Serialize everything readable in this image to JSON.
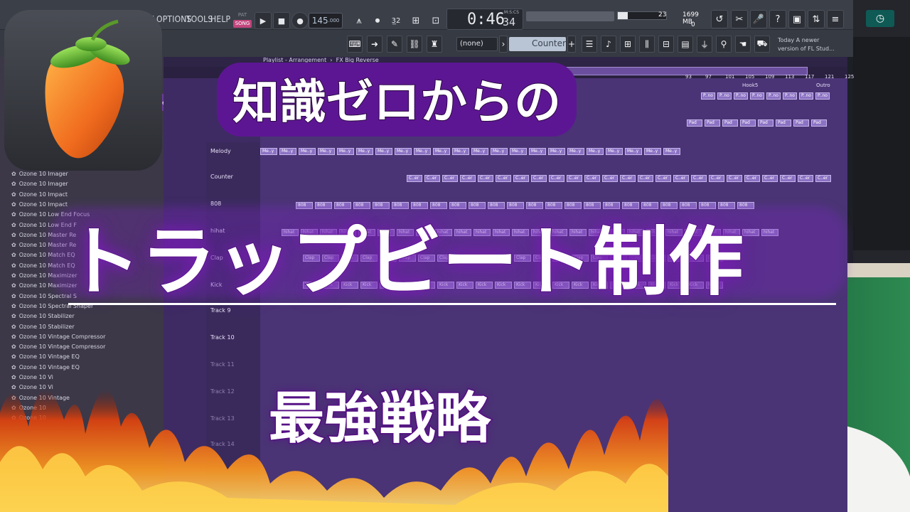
{
  "menu": {
    "items": [
      "W",
      "OPTIONS",
      "TOOLS",
      "HELP"
    ]
  },
  "transport": {
    "pat_label": "PAT",
    "song_label": "SONG",
    "tempo": "145",
    "tempo_fraction": ".000",
    "time_big": "0:46",
    "time_small": "34",
    "time_label": "M:S:CS"
  },
  "cpu": {
    "cpu_count": "23",
    "memory": "1699 MB",
    "voices": "0"
  },
  "toolbar2": {
    "pattern_select": "(none)",
    "counter_label": "Counter",
    "hint_line1": "Today  A newer",
    "hint_line2": "version of FL Stud..."
  },
  "playlist": {
    "title": "Playlist - Arrangement",
    "subtitle": "FX Big Reverse",
    "ruler": [
      "93",
      "97",
      "101",
      "105",
      "109",
      "113",
      "117",
      "121",
      "125"
    ],
    "markers": [
      "Hook5",
      "Outro"
    ],
    "tracks": [
      "Melody",
      "Counter",
      "808",
      "hihat",
      "Clap",
      "Kick",
      "Track 9",
      "Track 10",
      "Track 11",
      "Track 12",
      "Track 13",
      "Track 14"
    ],
    "reverse_label": "erse"
  },
  "clips": {
    "pno": "P..no",
    "pad": "Pad",
    "melody": "Me..y",
    "counter": "C..er",
    "808": "808",
    "hihat": "hihat",
    "clap": "Clap",
    "kick": "Kick"
  },
  "browser": {
    "plugins": [
      "Ozone 10 Imager",
      "Ozone 10 Imager",
      "Ozone 10 Impact",
      "Ozone 10 Impact",
      "Ozone 10 Low End Focus",
      "Ozone 10 Low End F",
      "Ozone 10 Master Re",
      "Ozone 10 Master Re",
      "Ozone 10 Match EQ",
      "Ozone 10 Match EQ",
      "Ozone 10 Maximizer",
      "Ozone 10 Maximizer",
      "Ozone 10 Spectral S",
      "Ozone 10 Spectral Shaper",
      "Ozone 10 Stabilizer",
      "Ozone 10 Stabilizer",
      "Ozone 10 Vintage Compressor",
      "Ozone 10 Vintage Compressor",
      "Ozone 10 Vintage EQ",
      "Ozone 10 Vintage EQ",
      "Ozone 10 Vi",
      "Ozone 10 Vi",
      "Ozone 10 Vintage",
      "Ozone 10",
      "Ozone 10"
    ]
  },
  "overlay": {
    "line1": "知識ゼロからの",
    "line2": "トラップビート制作",
    "line3": "最強戦略"
  },
  "colors": {
    "accent": "#5d1693",
    "playlist_bg": "#4a3475",
    "clip": "#8c72c4",
    "song_pink": "#c2467e"
  }
}
